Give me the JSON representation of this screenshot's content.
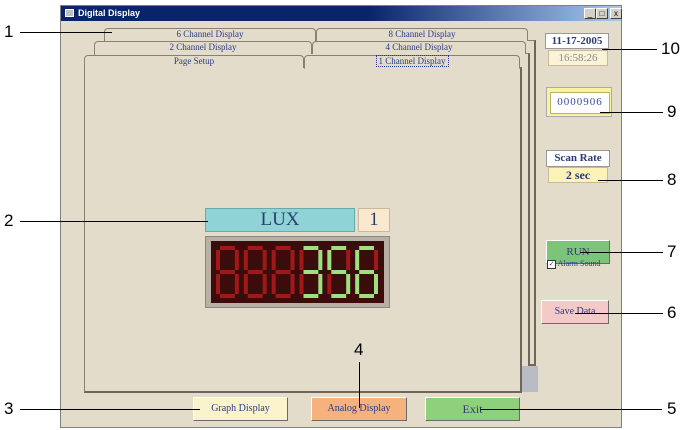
{
  "window": {
    "title": "Digital Display",
    "minimize_glyph": "_",
    "maximize_glyph": "□",
    "close_glyph": "x"
  },
  "tabs": {
    "row1": [
      "6 Channel Display",
      "8 Channel Display"
    ],
    "row2": [
      "2 Channel Display",
      "4 Channel Display"
    ],
    "row3": [
      "Page Setup",
      "1 Channel Display"
    ],
    "active": "1 Channel Display"
  },
  "display": {
    "unit": "LUX",
    "channel": "1",
    "reading": "356",
    "digit_count": 6,
    "off_color": "#a01818",
    "on_color": "#9ee07e"
  },
  "side": {
    "date": "11-17-2005",
    "time": "16:58:26",
    "counter": "0000906",
    "scan_rate_label": "Scan Rate",
    "scan_rate_value": "2 sec",
    "run_label": "RUN",
    "alarm_label": "Alarm Sound",
    "alarm_checked": true,
    "save_label": "Save Data"
  },
  "bottom": {
    "graph_label": "Graph Display",
    "analog_label": "Analog Display",
    "exit_label": "Exit"
  },
  "callouts": [
    "1",
    "2",
    "3",
    "4",
    "5",
    "6",
    "7",
    "8",
    "9",
    "10"
  ]
}
